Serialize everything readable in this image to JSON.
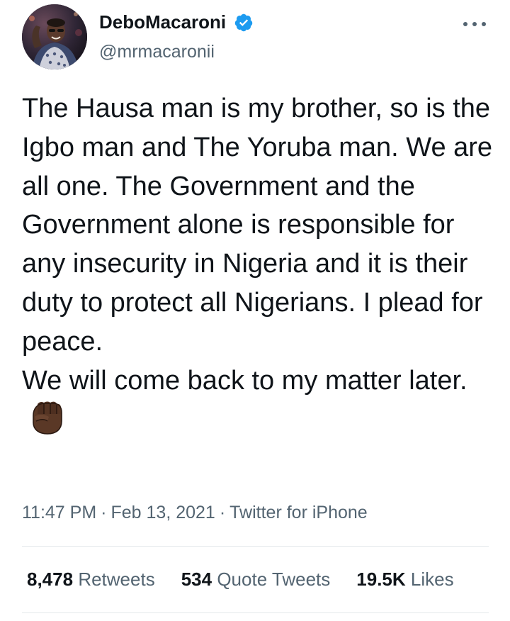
{
  "author": {
    "display_name": "DeboMacaroni",
    "handle": "@mrmacaronii",
    "verified": true,
    "verified_icon": "verified-badge-icon",
    "accent_color": "#1d9bf0"
  },
  "tweet": {
    "text": "The Hausa man is my brother, so is the Igbo man and The Yoruba man. We are all one. The Government and the Government alone is responsible for any insecurity in Nigeria and it is their duty to protect all Nigerians. I plead for peace.\nWe will come back to my matter later.",
    "emoji": "raised-fist-dark-skin-tone-icon"
  },
  "meta": {
    "time": "11:47 PM",
    "date": "Feb 13, 2021",
    "separator": "·",
    "source": "Twitter for iPhone"
  },
  "stats": {
    "retweets_count": "8,478",
    "retweets_label": "Retweets",
    "quotes_count": "534",
    "quotes_label": "Quote Tweets",
    "likes_count": "19.5K",
    "likes_label": "Likes"
  },
  "colors": {
    "text_primary": "#0f1419",
    "text_secondary": "#536471",
    "divider": "#e4e8eb"
  }
}
